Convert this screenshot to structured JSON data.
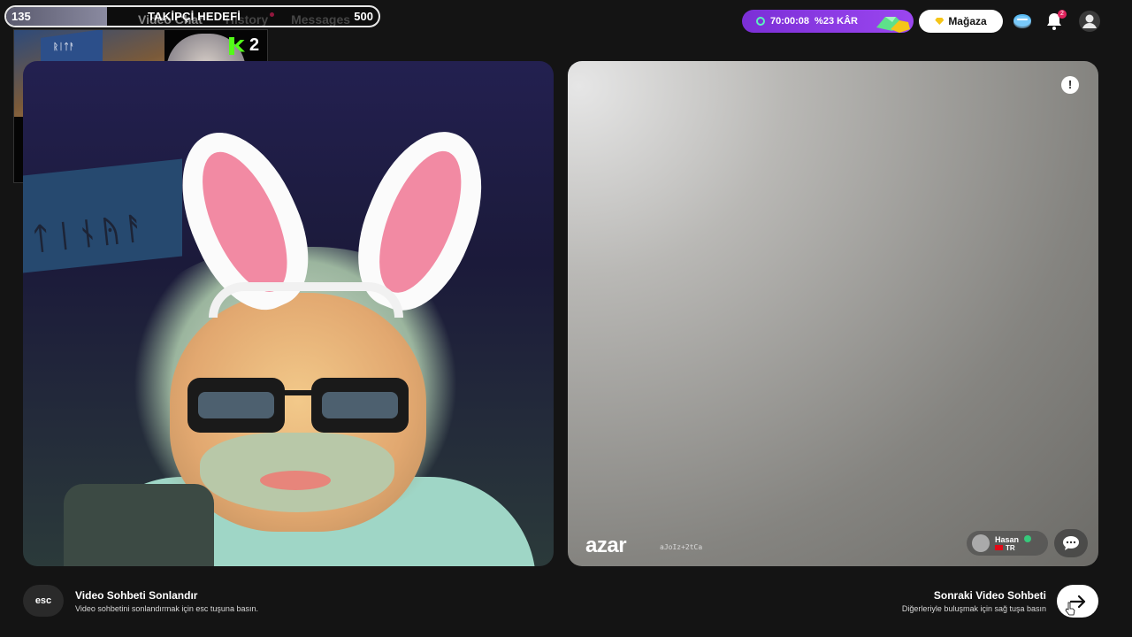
{
  "nav": {
    "tabs": [
      {
        "label": "Video Chat",
        "active": true
      },
      {
        "label": "History",
        "active": false,
        "has_dot": true
      },
      {
        "label": "Messages",
        "active": false
      }
    ]
  },
  "follower_goal": {
    "current": "135",
    "title": "TAKİPÇİ HEDEFİ",
    "target": "500",
    "progress": 0.27
  },
  "webcam_overlay": {
    "banner_text": "ᚱᛁᛏᚨ",
    "kick_count": "2",
    "kick_color": "#53fc18"
  },
  "header": {
    "timer": "70:00:08",
    "discount": "%23 KÂR",
    "store_label": "Mağaza",
    "notification_count": "2",
    "accent_purple": "#8a3be6"
  },
  "left_video": {
    "banner_text": "ᛏᛁᚾᚤᚨ"
  },
  "right_video": {
    "logo": "azar",
    "session_code": "aJoIz+2tCa",
    "user": {
      "name": "Hasan",
      "country": "TR"
    }
  },
  "bottom": {
    "esc_label": "esc",
    "end_title": "Video Sohbeti Sonlandır",
    "end_desc": "Video sohbetini sonlandırmak için esc tuşuna basın.",
    "next_title": "Sonraki Video Sohbeti",
    "next_desc": "Diğerleriyle buluşmak için sağ tuşa basın"
  }
}
